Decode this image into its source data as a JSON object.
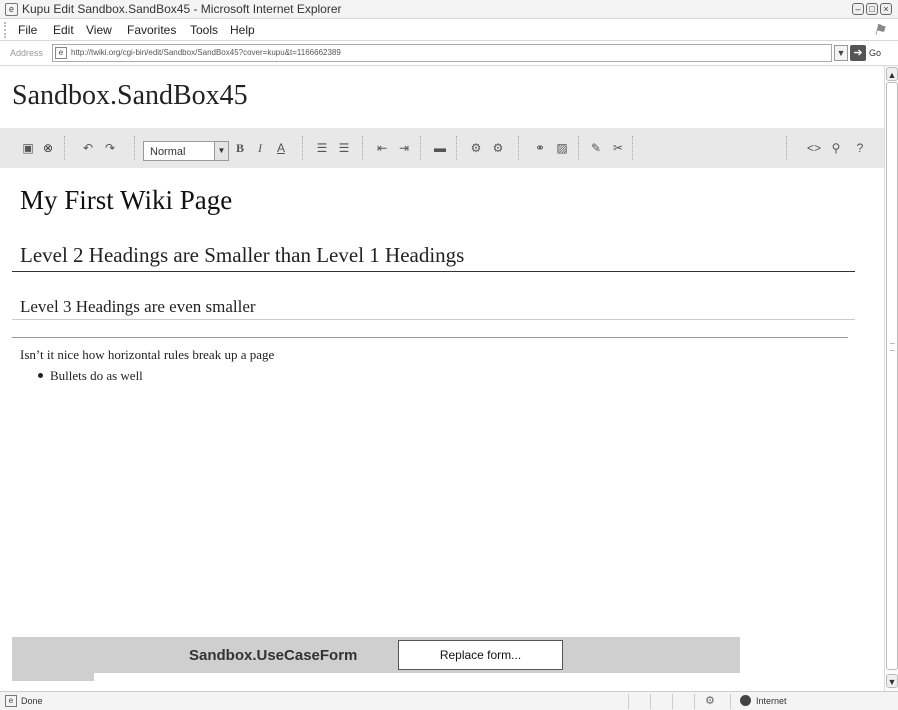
{
  "window": {
    "title": "Kupu Edit Sandbox.SandBox45 - Microsoft Internet Explorer",
    "controls": [
      "minimize",
      "maximize",
      "close"
    ]
  },
  "menu": {
    "items": [
      "File",
      "Edit",
      "View",
      "Favorites",
      "Tools",
      "Help"
    ]
  },
  "address": {
    "label": "Address",
    "url": "http://twiki.org/cgi-bin/edit/Sandbox/SandBox45?cover=kupu&t=1166662389",
    "go_label": "Go"
  },
  "page": {
    "heading": "Sandbox.SandBox45"
  },
  "toolbar": {
    "style_value": "Normal",
    "buttons": [
      "save-icon",
      "cancel-icon",
      "undo-icon",
      "redo-icon",
      "bold-icon",
      "italic-icon",
      "text-color-icon",
      "numbered-list-icon",
      "bullet-list-icon",
      "outdent-icon",
      "indent-icon",
      "table-icon",
      "image-icon",
      "attach-icon",
      "link-icon",
      "insert-image-icon",
      "form-icon",
      "anchor-icon",
      "source-icon",
      "zoom-icon",
      "help-icon"
    ]
  },
  "document": {
    "h1": "My First Wiki Page",
    "h2": "Level 2 Headings are Smaller than Level 1 Headings",
    "h3": "Level 3 Headings are even smaller",
    "paragraph": "Isn’t it nice how horizontal rules break up a page",
    "bullet": "Bullets do as well"
  },
  "form": {
    "name": "Sandbox.UseCaseForm",
    "replace_label": "Replace form..."
  },
  "status": {
    "text": "Done",
    "zone": "Internet"
  }
}
